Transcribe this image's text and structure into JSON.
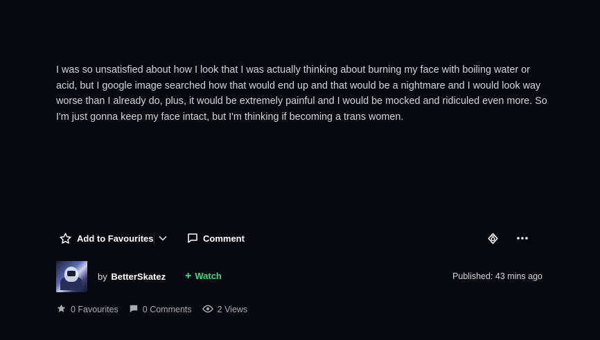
{
  "post": {
    "body": "I was so unsatisfied about how I look that I was actually thinking about burning my face with boiling water or acid, but I google image searched how that would end up and that would be a nightmare and I would look way worse than I already do, plus, it would be extremely painful and I would be mocked and ridiculed even more. So I'm just gonna keep my face intact, but I'm thinking if becoming a trans women."
  },
  "actions": {
    "favourite_label": "Add to Favourites",
    "comment_label": "Comment"
  },
  "author": {
    "by_prefix": "by",
    "username": "BetterSkatez",
    "watch_label": "Watch",
    "published": "Published: 43 mins ago"
  },
  "stats": {
    "favourites": "0 Favourites",
    "comments": "0 Comments",
    "views": "2 Views"
  },
  "colors": {
    "background": "#08090e",
    "accent_green": "#3ddc84",
    "text": "#d4d6dc"
  },
  "icons": [
    "star-outline-icon",
    "chevron-down-icon",
    "comment-icon",
    "badge-icon",
    "more-icon",
    "plus-icon",
    "star-icon",
    "comment-small-icon",
    "eye-icon"
  ]
}
